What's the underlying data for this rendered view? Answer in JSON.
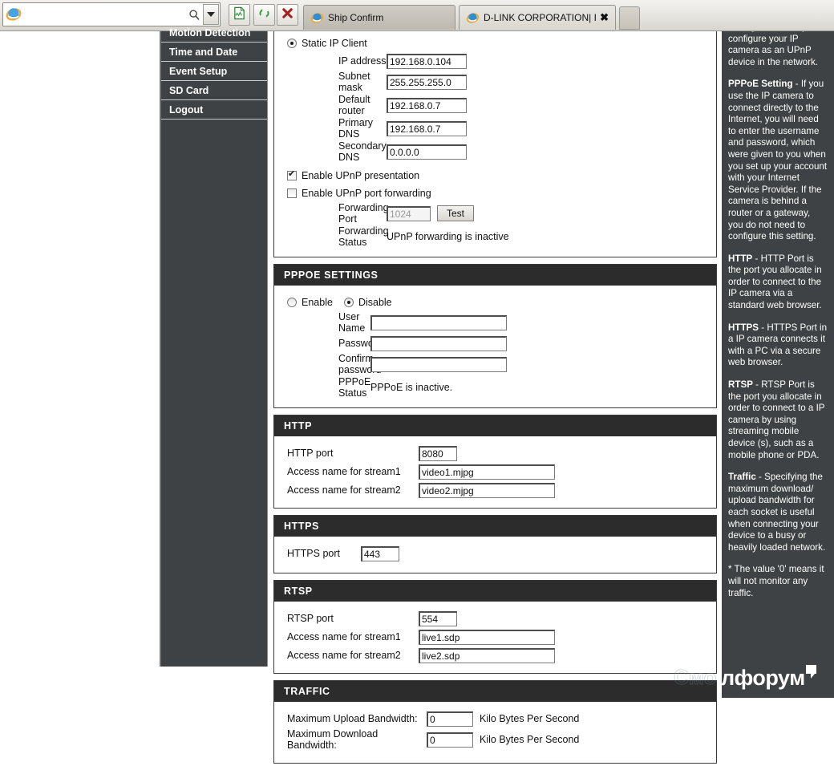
{
  "browser": {
    "address_value": "",
    "address_placeholder": "",
    "icons": {
      "ie_logo": "internet-explorer-logo-icon",
      "search": "search-icon",
      "dropdown": "chevron-down-icon",
      "page": "page-icon",
      "refresh": "refresh-icon",
      "stop": "stop-icon"
    },
    "tabs": [
      {
        "label": "Ship Confirm",
        "active": false,
        "closable": false
      },
      {
        "label": "D-LINK CORPORATION| INT...",
        "active": true,
        "closable": true,
        "close_label": "✖"
      }
    ],
    "new_tab_label": ""
  },
  "sidebar": {
    "items": [
      {
        "label": "Motion Detection"
      },
      {
        "label": "Time and Date"
      },
      {
        "label": "Event Setup"
      },
      {
        "label": "SD Card"
      },
      {
        "label": "Logout"
      }
    ]
  },
  "network": {
    "static_ip": {
      "radio_label": "Static IP Client",
      "selected": true,
      "fields": [
        {
          "label": "IP address",
          "value": "192.168.0.104"
        },
        {
          "label": "Subnet mask",
          "value": "255.255.255.0"
        },
        {
          "label": "Default router",
          "value": "192.168.0.7"
        },
        {
          "label": "Primary DNS",
          "value": "192.168.0.7"
        },
        {
          "label": "Secondary DNS",
          "value": "0.0.0.0"
        }
      ],
      "upnp_presentation": {
        "label": "Enable UPnP presentation",
        "checked": true
      },
      "upnp_forwarding": {
        "label": "Enable UPnP port forwarding",
        "checked": false
      },
      "forwarding_port": {
        "label": "Forwarding Port",
        "value": "1024",
        "button": "Test"
      },
      "forwarding_status": {
        "label": "Forwarding Status",
        "value": "UPnP forwarding is inactive"
      }
    },
    "pppoe": {
      "title": "PPPOE SETTINGS",
      "enable_label": "Enable",
      "disable_label": "Disable",
      "enable_selected": false,
      "disable_selected": true,
      "fields": [
        {
          "label": "User Name",
          "value": ""
        },
        {
          "label": "Password",
          "value": ""
        },
        {
          "label": "Confirm password",
          "value": ""
        }
      ],
      "status": {
        "label": "PPPoE Status",
        "value": "PPPoE is inactive."
      }
    },
    "http": {
      "title": "HTTP",
      "port": {
        "label": "HTTP port",
        "value": "8080"
      },
      "stream1": {
        "label": "Access name for stream1",
        "value": "video1.mjpg"
      },
      "stream2": {
        "label": "Access name for stream2",
        "value": "video2.mjpg"
      }
    },
    "https": {
      "title": "HTTPS",
      "port": {
        "label": "HTTPS port",
        "value": "443"
      }
    },
    "rtsp": {
      "title": "RTSP",
      "port": {
        "label": "RTSP port",
        "value": "554"
      },
      "stream1": {
        "label": "Access name for stream1",
        "value": "live1.sdp"
      },
      "stream2": {
        "label": "Access name for stream2",
        "value": "live2.sdp"
      }
    },
    "traffic": {
      "title": "TRAFFIC",
      "upload": {
        "label": "Maximum Upload Bandwidth:",
        "value": "0",
        "unit": "Kilo Bytes Per Second"
      },
      "download": {
        "label": "Maximum Download Bandwidth:",
        "value": "0",
        "unit": "Kilo Bytes Per Second"
      }
    }
  },
  "help": {
    "p0_cut": "settings will allow you to configure your IP camera as an UPnP device in the network.",
    "p1_title": "PPPoE Setting",
    "p1_body": " - If you use the IP camera to connect directly to the Internet, you will need to enter the username and password, which were given to you when you set up your account with your Internet Service Provider. If the camera is behind a router or a gateway, you do not need to configure this setting.",
    "p2_title": "HTTP",
    "p2_body": " - HTTP Port is the port you allocate in order to connect to the IP camera via a standard web browser.",
    "p3_title": "HTTPS",
    "p3_body": " - HTTPS Port in a IP camera connects it with a PC via a secure web browser.",
    "p4_title": "RTSP",
    "p4_body": " - RTSP Port is the port you allocate in order to connect to a IP camera by using streaming mobile device (s), such as a mobile phone or PDA.",
    "p5_title": "Traffic",
    "p5_body": " - Specifying the maximum download/ upload bandwidth for each socket is useful when connecting your device to a busy or heavily loaded network.",
    "p6": "* The value '0' means it will not monitor any traffic."
  },
  "watermark": {
    "text": "лфорум",
    "ghost": "Смо"
  },
  "colors": {
    "sidebar_bg": "#3e4244",
    "panel_header_bg": "#2c2c2c",
    "page_bg": "#ffffff",
    "chrome_bg": "#e6e4df"
  }
}
